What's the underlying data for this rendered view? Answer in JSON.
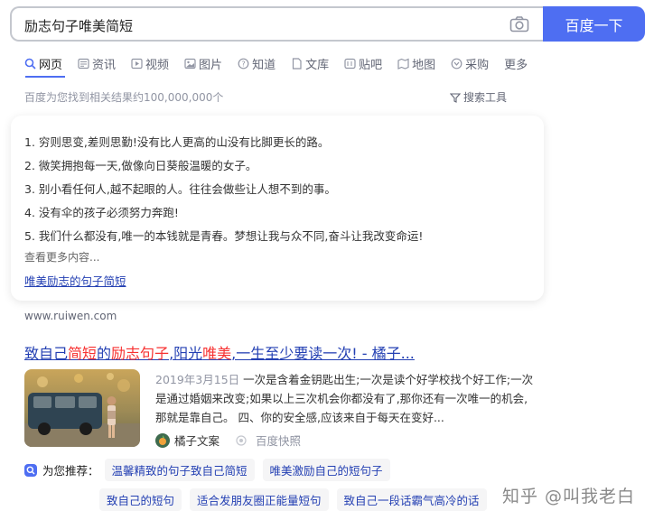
{
  "search": {
    "query": "励志句子唯美简短",
    "button_label": "百度一下"
  },
  "tabs": [
    {
      "label": "网页",
      "icon": "search-icon"
    },
    {
      "label": "资讯",
      "icon": "news-icon"
    },
    {
      "label": "视频",
      "icon": "video-icon"
    },
    {
      "label": "图片",
      "icon": "image-icon"
    },
    {
      "label": "知道",
      "icon": "question-icon"
    },
    {
      "label": "文库",
      "icon": "document-icon"
    },
    {
      "label": "贴吧",
      "icon": "tieba-icon"
    },
    {
      "label": "地图",
      "icon": "map-icon"
    },
    {
      "label": "采购",
      "icon": "purchase-icon"
    },
    {
      "label": "更多",
      "icon": ""
    }
  ],
  "result_count": "百度为您找到相关结果约100,000,000个",
  "tools_label": "搜索工具",
  "card": {
    "lines": [
      "1. 穷则思变,差则思勤!没有比人更高的山没有比脚更长的路。",
      "2. 微笑拥抱每一天,做像向日葵般温暖的女子。",
      "3. 别小看任何人,越不起眼的人。往往会做些让人想不到的事。",
      "4. 没有伞的孩子必须努力奔跑!",
      "5. 我们什么都没有,唯一的本钱就是青春。梦想让我与众不同,奋斗让我改变命运!"
    ],
    "more_label": "查看更多内容...",
    "link_label": "唯美励志的句子简短"
  },
  "result": {
    "source_url": "www.ruiwen.com",
    "title_parts": [
      {
        "text": "致自己",
        "hl": false
      },
      {
        "text": "简短",
        "hl": true
      },
      {
        "text": "的",
        "hl": false
      },
      {
        "text": "励志句子",
        "hl": true
      },
      {
        "text": ",阳光",
        "hl": false
      },
      {
        "text": "唯美",
        "hl": true
      },
      {
        "text": ",一生至少要读一次! - 橘子...",
        "hl": false
      }
    ],
    "date": "2019年3月15日",
    "snippet": "一次是含着金钥匙出生;一次是读个好学校找个好工作;一次是通过婚姻来改变;如果以上三次机会你都没有了,那你还有一次唯一的机会,那就是靠自己。 四、你的安全感,应该来自于每天在变好...",
    "site_name": "橘子文案",
    "kuaizhao": "百度快照"
  },
  "recommend": {
    "label": "为您推荐：",
    "row1": [
      "温馨精致的句子致自己简短",
      "唯美激励自己的短句子"
    ],
    "row2": [
      "致自己的短句",
      "适合发朋友圈正能量短句",
      "致自己一段话霸气高冷的话"
    ]
  },
  "watermark": "知乎 @叫我老白",
  "colors": {
    "accent": "#4e6ef2",
    "link": "#2440b3",
    "highlight": "#f73131"
  }
}
